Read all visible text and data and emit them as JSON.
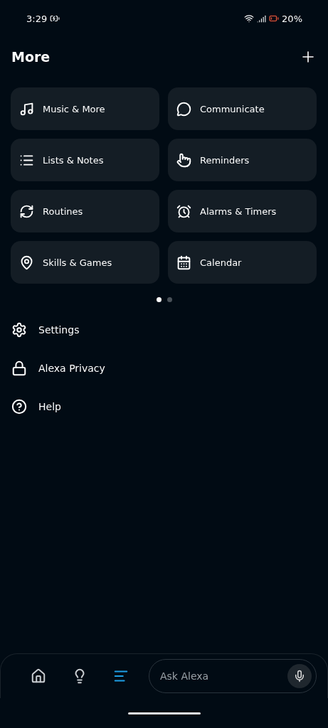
{
  "status_bar": {
    "time": "3:29",
    "battery": "20%"
  },
  "header": {
    "title": "More"
  },
  "tiles": [
    {
      "kind": "music",
      "label": "Music & More"
    },
    {
      "kind": "communicate",
      "label": "Communicate"
    },
    {
      "kind": "lists",
      "label": "Lists & Notes"
    },
    {
      "kind": "reminders",
      "label": "Reminders"
    },
    {
      "kind": "routines",
      "label": "Routines"
    },
    {
      "kind": "alarms",
      "label": "Alarms & Timers"
    },
    {
      "kind": "skills",
      "label": "Skills & Games"
    },
    {
      "kind": "calendar",
      "label": "Calendar"
    }
  ],
  "page_dots": [
    {
      "selected": true
    },
    {
      "selected": false
    }
  ],
  "menu": [
    {
      "kind": "settings",
      "label": "Settings"
    },
    {
      "kind": "privacy",
      "label": "Alexa Privacy"
    },
    {
      "kind": "help",
      "label": "Help"
    }
  ],
  "nav": {
    "tabs": [
      {
        "kind": "home",
        "selected": false
      },
      {
        "kind": "devices",
        "selected": false
      },
      {
        "kind": "more",
        "selected": true
      }
    ],
    "search": {
      "placeholder": "Ask Alexa"
    }
  }
}
